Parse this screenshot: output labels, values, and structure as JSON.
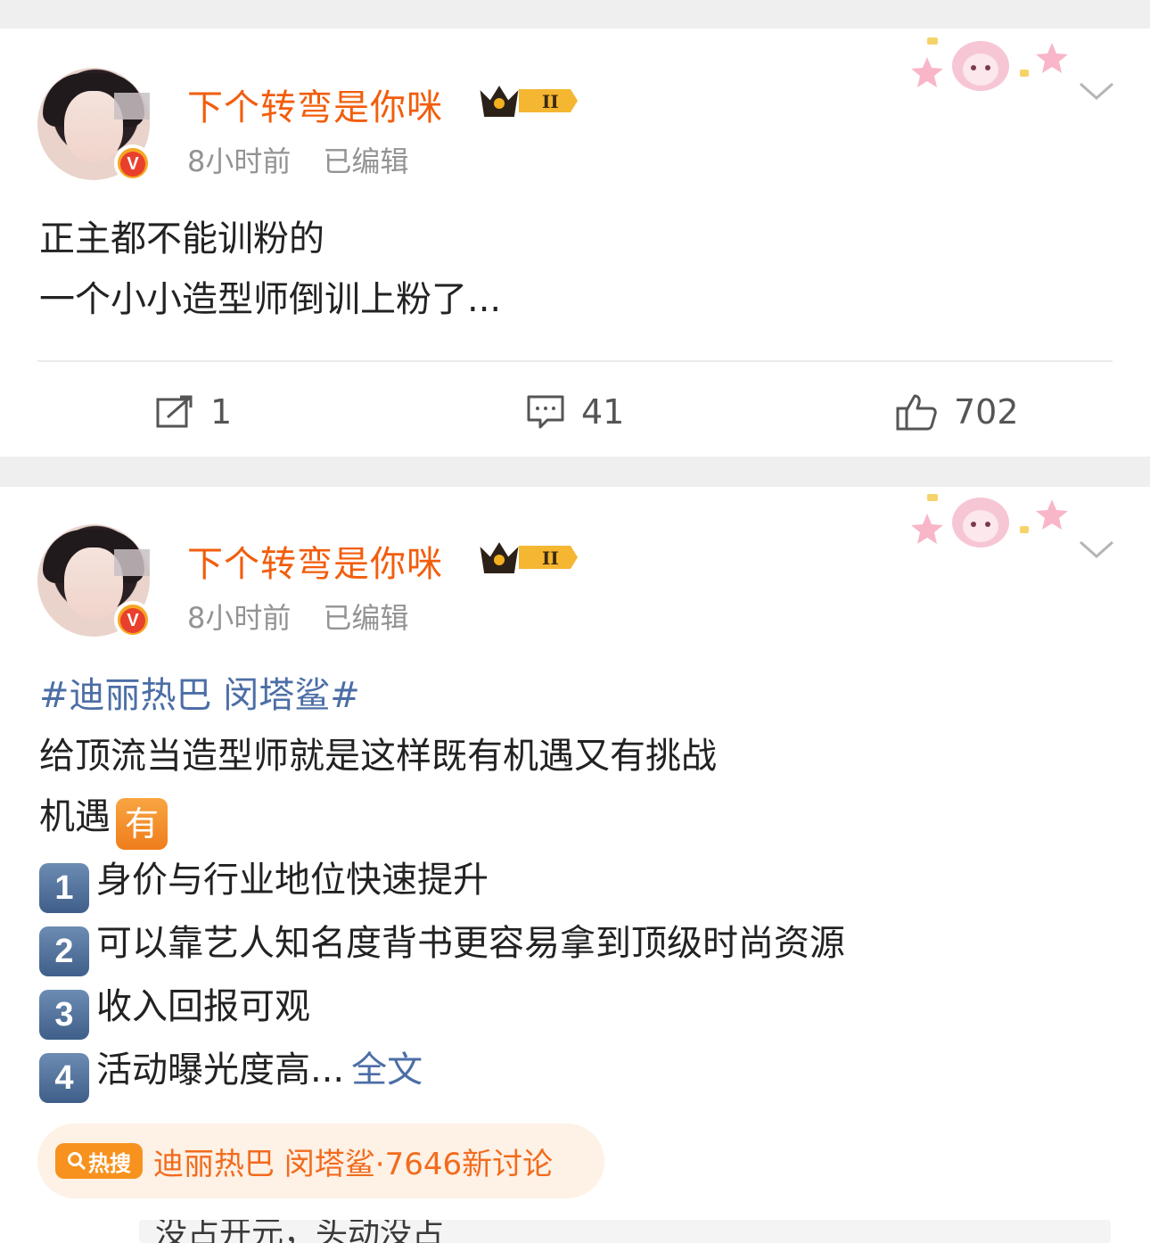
{
  "posts": [
    {
      "username": "下个转弯是你咪",
      "crown_level": "II",
      "time": "8小时前",
      "edited": "已编辑",
      "lines": [
        "正主都不能训粉的",
        "一个小小造型师倒训上粉了..."
      ],
      "actions": {
        "repost": "1",
        "comments": "41",
        "likes": "702"
      }
    },
    {
      "username": "下个转弯是你咪",
      "crown_level": "II",
      "time": "8小时前",
      "edited": "已编辑",
      "hashtag": "#迪丽热巴 闵塔鲨#",
      "intro": "给顶流当造型师就是这样既有机遇又有挑战",
      "opportunity_label": "机遇",
      "opportunity_emoji": "有",
      "points": [
        {
          "num": "1",
          "text": "身价与行业地位快速提升"
        },
        {
          "num": "2",
          "text": "可以靠艺人知名度背书更容易拿到顶级时尚资源"
        },
        {
          "num": "3",
          "text": "收入回报可观"
        },
        {
          "num": "4",
          "text": "活动曝光度高..."
        }
      ],
      "more_label": "全文",
      "hot_badge": "热搜",
      "hot_text": "迪丽热巴 闵塔鲨·7646新讨论",
      "peek_text": "没占开元，头动没占"
    }
  ],
  "colors": {
    "username": "#f25d0c",
    "link": "#4c6ea6",
    "meta": "#939393",
    "hot": "#f26b1d"
  }
}
